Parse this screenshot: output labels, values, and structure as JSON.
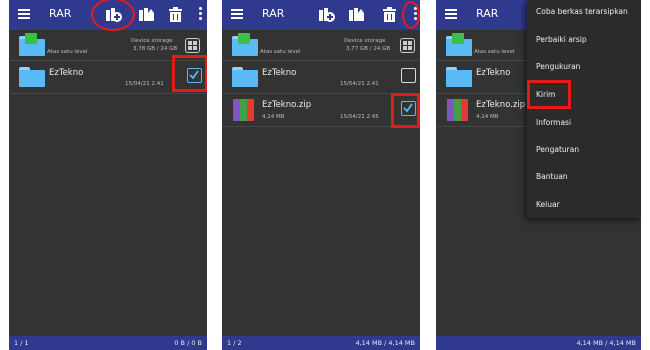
{
  "app": {
    "title": "RAR"
  },
  "icons": {
    "menu": "hamburger-icon",
    "add": "add-to-archive-icon",
    "extract": "extract-icon",
    "delete": "trash-icon",
    "more": "more-vertical-icon",
    "view": "grid-view-icon"
  },
  "colors": {
    "appbar": "#2f3a8f",
    "folder": "#5ab9f7",
    "highlight": "#e31b1b",
    "background": "#333333"
  },
  "panel1": {
    "up_item": {
      "label": "Atas satu level",
      "location": "Device storage",
      "storage": "3,78 GB / 24 GB"
    },
    "items": [
      {
        "name": "EzTekno",
        "date": "15/04/21 2.41",
        "checked": true
      }
    ],
    "status_left": "1 / 1",
    "status_right": "0 B / 0 B"
  },
  "panel2": {
    "up_item": {
      "label": "Atas satu level",
      "location": "Device storage",
      "storage": "3,77 GB / 24 GB"
    },
    "items": [
      {
        "name": "EzTekno",
        "date": "15/04/21 2.41",
        "checked": false
      },
      {
        "name": "EzTekno.zip",
        "size": "4,14 MB",
        "date": "15/04/21 2.45",
        "checked": true
      }
    ],
    "status_left": "1 / 2",
    "status_right": "4,14 MB / 4,14 MB"
  },
  "panel3": {
    "up_item": {
      "label": "Atas satu level"
    },
    "items": [
      {
        "name": "EzTekno"
      },
      {
        "name": "EzTekno.zip",
        "size": "4,14 MB"
      }
    ],
    "status_right": "4,14 MB / 4,14 MB",
    "menu": [
      "Coba berkas terarsipkan",
      "Perbaiki arsip",
      "Pengukuran",
      "Kirim",
      "Informasi",
      "Pengaturan",
      "Bantuan",
      "Keluar"
    ]
  }
}
